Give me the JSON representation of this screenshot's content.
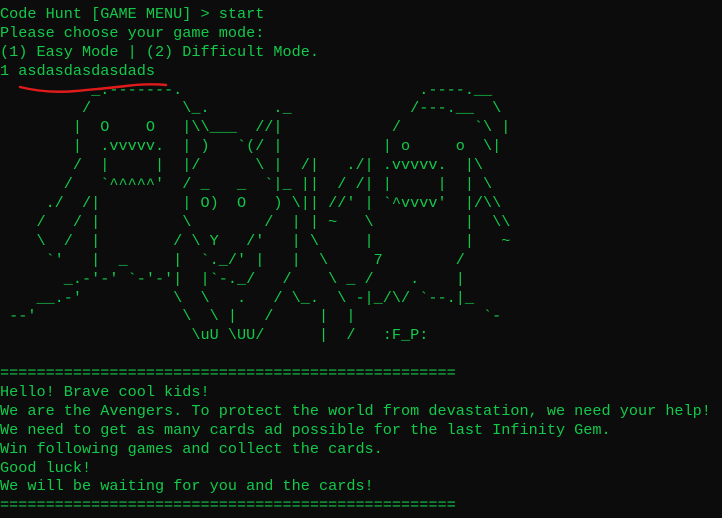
{
  "terminal": {
    "prompt": "Code Hunt [GAME MENU] > start",
    "choose": "Please choose your game mode:",
    "modes": "(1) Easy Mode | (2) Difficult Mode.",
    "user_input": "1 asdasdasdasdads",
    "ascii_art": "          _.-------.                          .----.__\n         /          \\_.       ._             /---.__  \\\n        |  O    O   |\\\\___  //|            /        `\\ |\n        |  .vvvvv.  | )   `(/ |           | o     o  \\|\n        /  |     |  |/      \\ |  /|   ./| .vvvvv.  |\\\n       /   `^^^^^'  / _   _  `|_ ||  / /| |     |  | \\\n     ./  /|         | O)  O   ) \\|| //' | `^vvvv'  |/\\\\\n    /   / |         \\        /  | | ~   \\          |  \\\\\n    \\  /  |        / \\ Y   /'   | \\     |          |   ~\n     `'   |  _     |  `._/' |   |  \\     7        /\n       _.-'-' `-'-'|  |`-._/   /    \\ _ /    .    |\n    __.-'          \\  \\   .   / \\_.  \\ -|_/\\/ `--.|_\n --'                \\  \\ |   /     |  |              `-\n                     \\uU \\UU/      |  /   :F_P:",
    "separator": "==================================================",
    "messages": [
      "Hello! Brave cool kids!",
      "We are the Avengers. To protect the world from devastation, we need your help!",
      "We need to get as many cards ad possible for the last Infinity Gem.",
      "Win following games and collect the cards.",
      "Good luck!",
      "We will be waiting for you and the cards!"
    ]
  },
  "colors": {
    "background": "#0c0c0c",
    "text": "#13c94a",
    "annotation": "#e01b1b"
  }
}
